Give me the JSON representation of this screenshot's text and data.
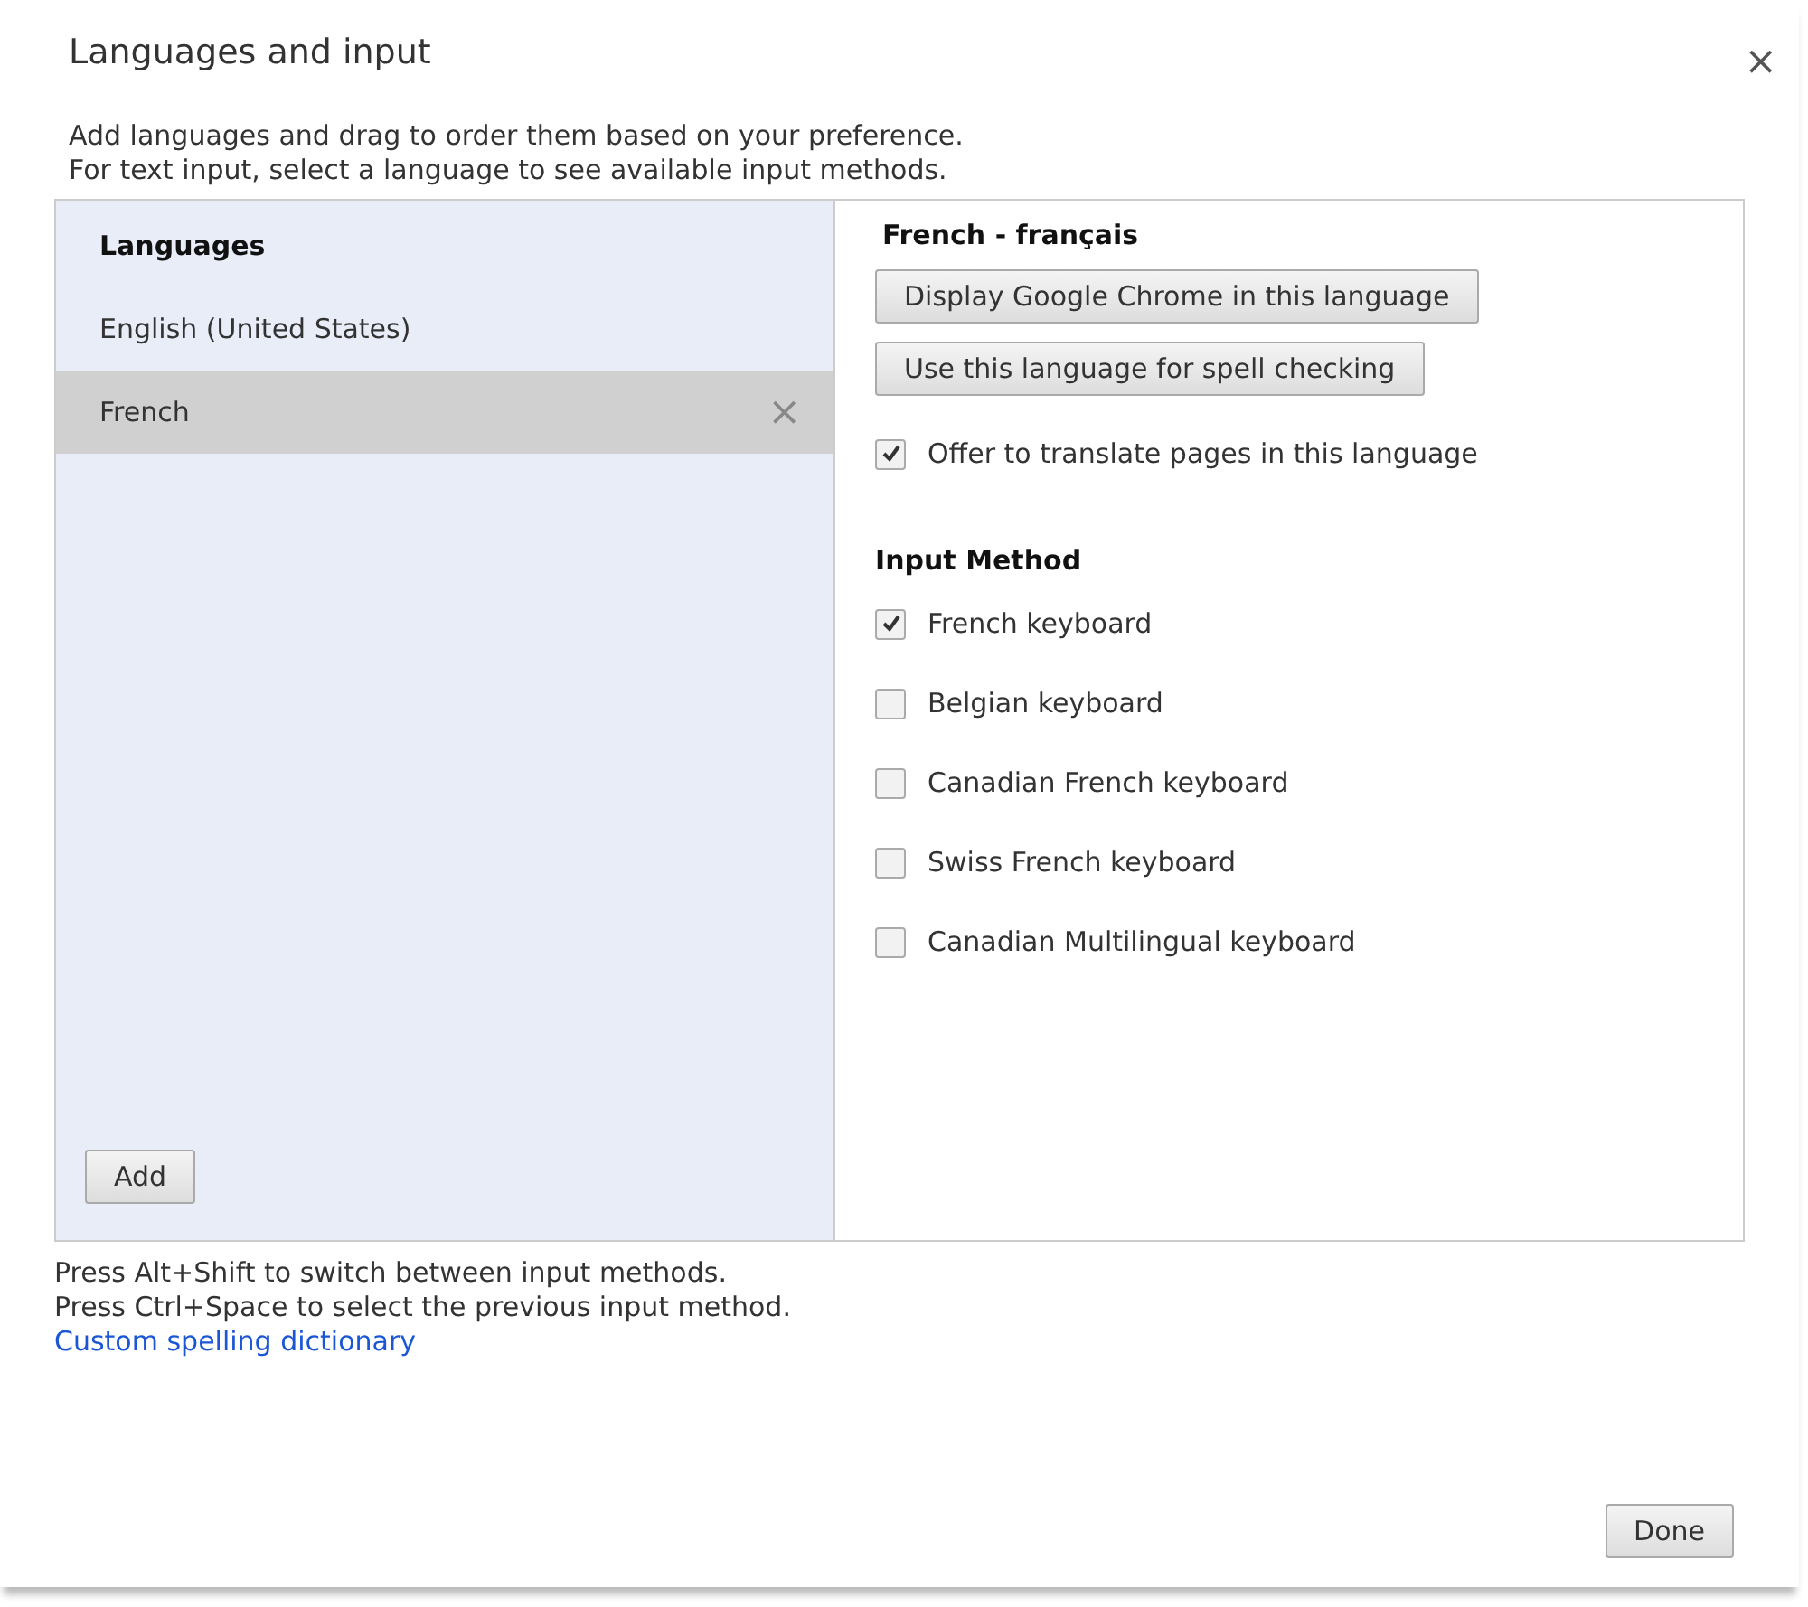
{
  "dialog": {
    "title": "Languages and input",
    "close": "×"
  },
  "intro": [
    "Add languages and drag to order them based on your preference.",
    "For text input, select a language to see available input methods."
  ],
  "languages": {
    "heading": "Languages",
    "items": [
      {
        "label": "English (United States)",
        "selected": false
      },
      {
        "label": "French",
        "selected": true,
        "remove": "×"
      }
    ],
    "add_button": "Add"
  },
  "details": {
    "heading": "French - français",
    "buttons": [
      "Display Google Chrome in this language",
      "Use this language for spell checking"
    ],
    "translate": {
      "label": "Offer to translate pages in this language",
      "checked": true
    },
    "input_heading": "Input Method",
    "input_methods": [
      {
        "label": "French keyboard",
        "checked": true
      },
      {
        "label": "Belgian keyboard",
        "checked": false
      },
      {
        "label": "Canadian French keyboard",
        "checked": false
      },
      {
        "label": "Swiss French keyboard",
        "checked": false
      },
      {
        "label": "Canadian Multilingual keyboard",
        "checked": false
      }
    ]
  },
  "hints": [
    "Press Alt+Shift to switch between input methods.",
    "Press Ctrl+Space to select the previous input method."
  ],
  "link": "Custom spelling dictionary",
  "done_button": "Done"
}
